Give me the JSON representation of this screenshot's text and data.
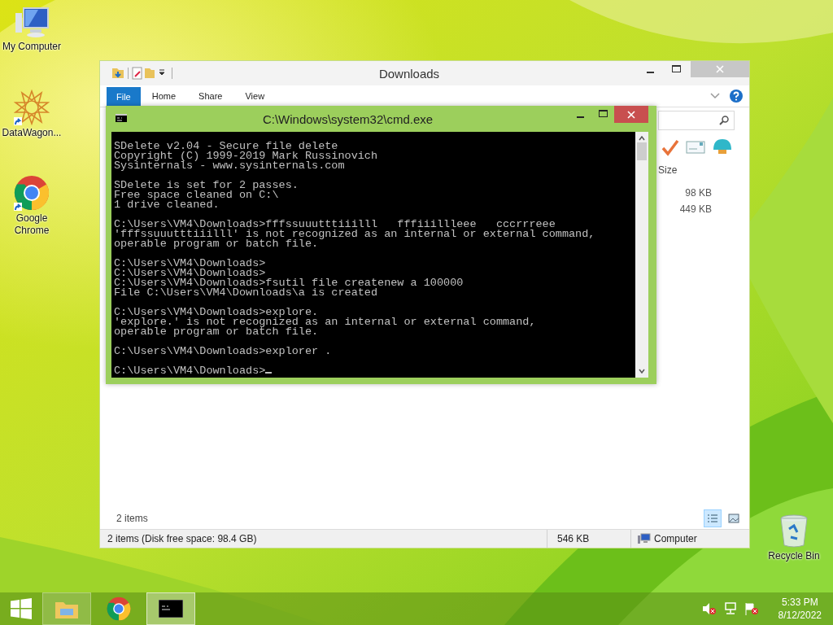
{
  "desktop": {
    "icons": [
      {
        "label": "My Computer",
        "kind": "computer",
        "shortcut": false
      },
      {
        "label": "DataWagon...",
        "kind": "star",
        "shortcut": true
      },
      {
        "label": "Google Chrome",
        "kind": "chrome",
        "shortcut": true
      }
    ],
    "recycle_bin": {
      "label": "Recycle Bin"
    }
  },
  "explorer": {
    "title": "Downloads",
    "tabs": [
      {
        "label": "File",
        "selected": true
      },
      {
        "label": "Home",
        "selected": false
      },
      {
        "label": "Share",
        "selected": false
      },
      {
        "label": "View",
        "selected": false
      }
    ],
    "column": "Size",
    "rows": [
      {
        "size": "98 KB"
      },
      {
        "size": "449 KB"
      }
    ],
    "item_count": "2 items",
    "views": [
      {
        "kind": "details",
        "selected": true
      },
      {
        "kind": "thumbnails",
        "selected": false
      }
    ],
    "status_bar": {
      "summary": "2 items (Disk free space: 98.4 GB)",
      "size": "546 KB",
      "location": "Computer"
    }
  },
  "cmd": {
    "title": "C:\\Windows\\system32\\cmd.exe",
    "blocks": [
      [
        "SDelete v2.04 - Secure file delete",
        "Copyright (C) 1999-2019 Mark Russinovich",
        "Sysinternals - www.sysinternals.com"
      ],
      [
        "SDelete is set for 2 passes.",
        "Free space cleaned on C:\\",
        "1 drive cleaned."
      ],
      [
        "C:\\Users\\VM4\\Downloads>fffssuuutttiiilll   fffiiillleee   cccrrreee",
        "'fffssuuutttiiilll' is not recognized as an internal or external command,",
        "operable program or batch file."
      ],
      [
        "C:\\Users\\VM4\\Downloads>",
        "C:\\Users\\VM4\\Downloads>",
        "C:\\Users\\VM4\\Downloads>fsutil file createnew a 100000",
        "File C:\\Users\\VM4\\Downloads\\a is created"
      ],
      [
        "C:\\Users\\VM4\\Downloads>explore.",
        "'explore.' is not recognized as an internal or external command,",
        "operable program or batch file."
      ],
      [
        "C:\\Users\\VM4\\Downloads>explorer ."
      ],
      [
        "C:\\Users\\VM4\\Downloads>"
      ]
    ]
  },
  "taskbar": {
    "apps": [
      {
        "kind": "explorer",
        "open": true,
        "selected": false
      },
      {
        "kind": "chrome",
        "open": false,
        "selected": false
      },
      {
        "kind": "console",
        "open": true,
        "selected": true
      }
    ],
    "time": "5:33 PM",
    "date": "8/12/2022"
  }
}
